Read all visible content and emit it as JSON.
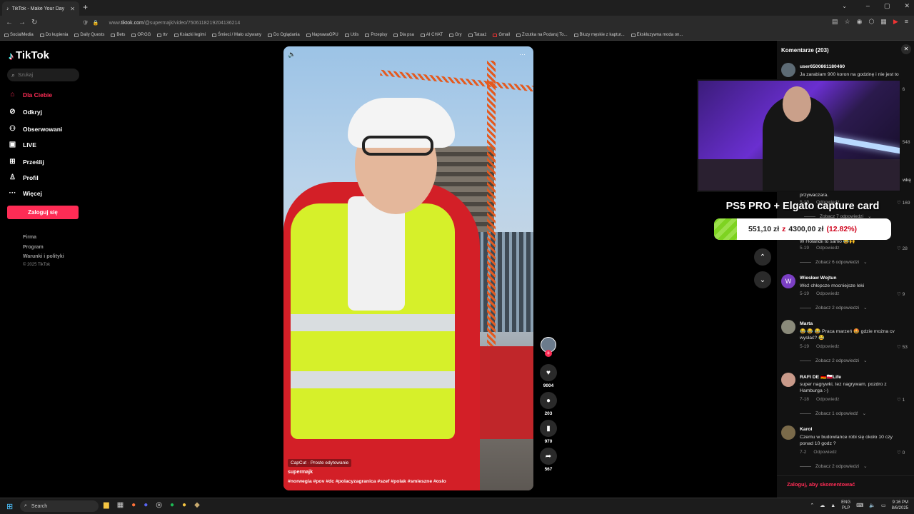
{
  "browser": {
    "tab_title": "TikTok - Make Your Day",
    "url_prefix": "www.",
    "url_host": "tiktok.com",
    "url_path": "/@supermajk/video/7506118219204136214",
    "bookmarks": [
      "SocialMedia",
      "Do kupienia",
      "Daily Quests",
      "Bets",
      "OP.GG",
      "ttv",
      "Ksiazki legimi",
      "Śmieci / Mało używany",
      "Do Oglądania",
      "NaprawaGPU",
      "Utils",
      "Przepisy",
      "Dla psa",
      "AI CHAT",
      "Gry",
      "Tatuaż",
      "Gmail",
      "Zrzutka na Podaruj To...",
      "Bluzy męskie z kaptur...",
      "Ekskluzywna moda on..."
    ]
  },
  "sidebar": {
    "logo": "TikTok",
    "search_placeholder": "Szukaj",
    "items": [
      {
        "label": "Dla Ciebie",
        "icon": "home-icon"
      },
      {
        "label": "Odkryj",
        "icon": "compass-icon"
      },
      {
        "label": "Obserwowani",
        "icon": "following-icon"
      },
      {
        "label": "LIVE",
        "icon": "live-icon"
      },
      {
        "label": "Prześlij",
        "icon": "upload-icon"
      },
      {
        "label": "Profil",
        "icon": "profile-icon"
      },
      {
        "label": "Więcej",
        "icon": "more-icon"
      }
    ],
    "login_label": "Zaloguj się",
    "footer_links": [
      "Firma",
      "Program",
      "Warunki i polityki"
    ],
    "copyright": "© 2025 TikTok"
  },
  "video": {
    "capcut_label": "CapCut · Proste edytowanie",
    "author": "supermajk",
    "tags": "#norwegia #pov #dc #polacyzagranica #szef #polak #smieszne #oslo",
    "likes": "9004",
    "comments": "203",
    "saves": "970",
    "shares": "567"
  },
  "comments_panel": {
    "header": "Komentarze (203)",
    "reply_label": "Odpowiedz",
    "login_prompt": "Zaloguj, aby skomentować",
    "items": [
      {
        "user": "user6500861180460",
        "text": "Ja zarabiam 900 koron na godzinę i nie jest to",
        "likes": "6"
      },
      {
        "user": "Wiesław Wojtun",
        "text": "Weź chłopcze mocniejsze leki",
        "date": "5-19",
        "likes": "9",
        "replies": "Zobacz 2 odpowiedzi"
      },
      {
        "user": "Marta",
        "text": "😂 😂 😂 Praca marzeń 🤩 gdzie można cv wysłać? 😂",
        "date": "5-19",
        "likes": "53",
        "replies": "Zobacz 2 odpowiedzi"
      },
      {
        "user": "RAFI DE 🇩🇪🇵🇱Life",
        "text": "super nagrywki, tez nagrywam, pozdro z Hamburga :-)",
        "date": "7-18",
        "likes": "1",
        "replies": "Zobacz 1 odpowiedź"
      },
      {
        "user": "Karol",
        "text": "Czemu w budowlance robi się około 10 czy ponad 10 godz ?",
        "date": "7-2",
        "likes": "0",
        "replies": "Zobacz 2 odpowiedzi"
      }
    ],
    "partial": {
      "text1": "przywaczara.",
      "date1": "5-19",
      "likes_a": "548",
      "likes_b": "169",
      "text_b": "wkę",
      "replies_a": "Zobacz 7 odpowiedzi",
      "text2": "W Holandii to samo 😂🙌",
      "date2": "5-19",
      "likes2": "28",
      "replies2": "Zobacz 6 odpowiedzi"
    }
  },
  "overlay": {
    "goal_title": "PS5 PRO + Elgato capture card",
    "current": "551,10 zł",
    "sep": "z",
    "target": "4300,00 zł",
    "percent": "(12.82%)",
    "progress": 0.1282
  },
  "taskbar": {
    "search_label": "Search",
    "lang_1": "ENG",
    "lang_2": "PLP",
    "time": "9:16 PM",
    "date": "8/6/2025"
  }
}
